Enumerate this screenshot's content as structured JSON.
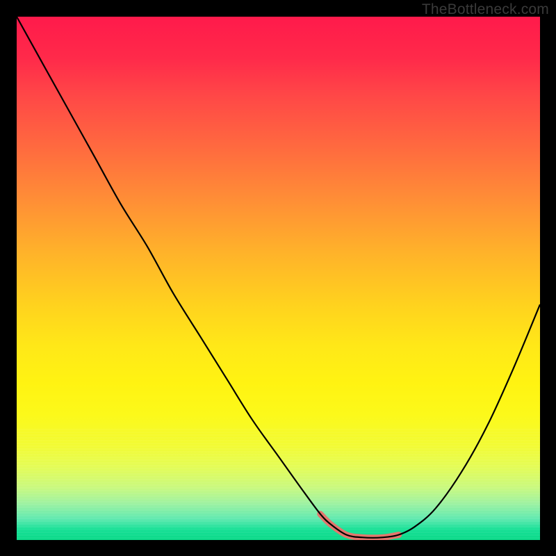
{
  "watermark": "TheBottleneck.com",
  "colors": {
    "frame": "#000000",
    "curve": "#000000",
    "highlight": "#e4766d"
  },
  "chart_data": {
    "type": "line",
    "title": "",
    "xlabel": "",
    "ylabel": "",
    "xlim": [
      0,
      100
    ],
    "ylim": [
      0,
      100
    ],
    "grid": false,
    "series": [
      {
        "name": "bottleneck-curve",
        "x": [
          0,
          5,
          10,
          15,
          20,
          25,
          30,
          35,
          40,
          45,
          50,
          55,
          58,
          60,
          63,
          66,
          70,
          73,
          76,
          80,
          85,
          90,
          95,
          100
        ],
        "y": [
          100,
          91,
          82,
          73,
          64,
          56,
          47,
          39,
          31,
          23,
          16,
          9,
          5,
          3,
          1,
          0.5,
          0.5,
          1,
          2.5,
          6,
          13,
          22,
          33,
          45
        ]
      }
    ],
    "highlight_range_x": [
      57,
      73
    ],
    "annotations": []
  }
}
